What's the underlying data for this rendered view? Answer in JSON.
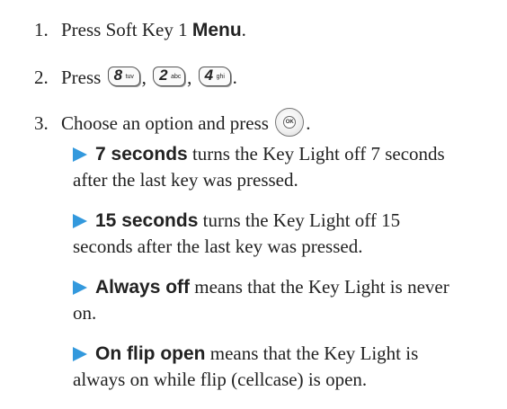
{
  "steps": [
    {
      "num": "1.",
      "text": "Press Soft Key 1 ",
      "bold": "Menu",
      "suffix": "."
    },
    {
      "num": "2.",
      "text": "Press ",
      "keys": [
        {
          "digit": "8",
          "letters": "tuv"
        },
        {
          "digit": "2",
          "letters": "abc"
        },
        {
          "digit": "4",
          "letters": "ghi"
        }
      ],
      "sep": ",",
      "suffix": "."
    },
    {
      "num": "3.",
      "text": "Choose an option and press ",
      "ok_label": "OK",
      "suffix": "."
    }
  ],
  "bullets": [
    {
      "bold": "7 seconds",
      "line1": " turns the Key Light off 7 seconds",
      "line2": "after the last key was pressed."
    },
    {
      "bold": "15 seconds",
      "line1": " turns the Key Light off 15",
      "line2": "seconds after the last key was pressed."
    },
    {
      "bold": "Always off",
      "line1": " means that the Key Light is never",
      "line2": "on."
    },
    {
      "bold": "On flip open",
      "line1": " means that the Key Light is",
      "line2": "always on while flip (cellcase) is open."
    }
  ],
  "colors": {
    "bullet_arrow": "#3399dd",
    "text": "#222222"
  }
}
